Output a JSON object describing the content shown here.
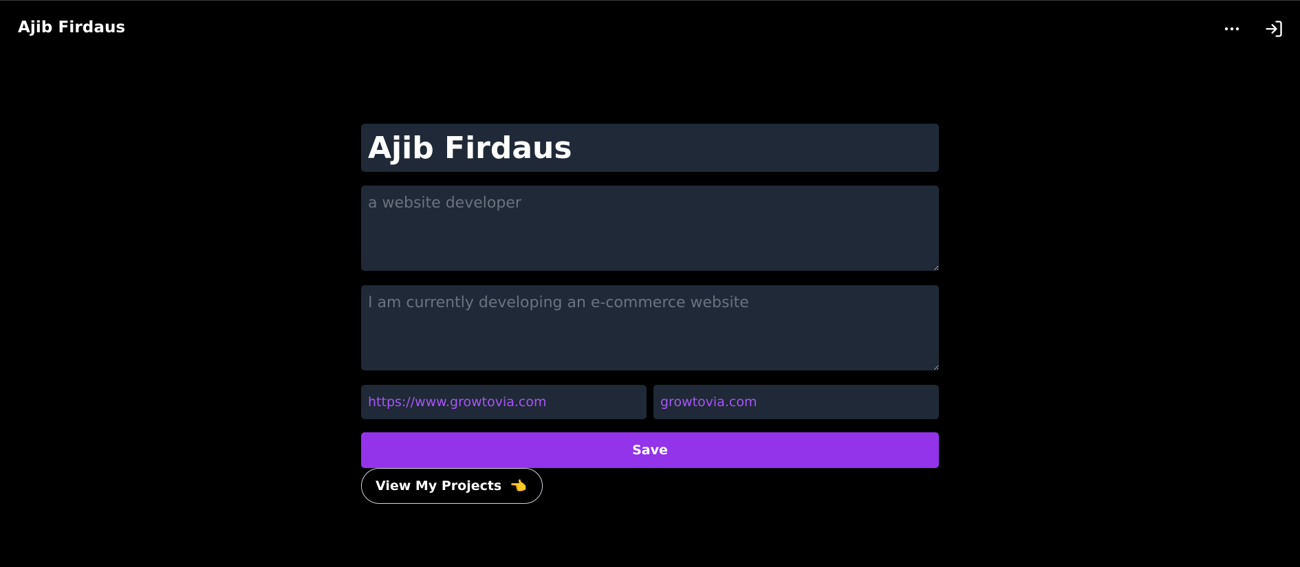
{
  "header": {
    "brand": "Ajib Firdaus",
    "more_icon": "more-horizontal-icon",
    "login_icon": "login-icon"
  },
  "form": {
    "name_value": "Ajib Firdaus",
    "headline_placeholder": "a website developer",
    "headline_value": "",
    "about_placeholder": "I am currently developing an e-commerce website",
    "about_value": "",
    "link_url_placeholder": "https://www.growtovia.com",
    "link_label_placeholder": "growtovia.com",
    "save_label": "Save",
    "projects_label": "View My Projects",
    "projects_emoji": "👈"
  },
  "colors": {
    "background": "#000000",
    "field_bg": "#1f2937",
    "accent": "#9333ea",
    "link_text": "#a855f7",
    "placeholder": "#6b7280"
  }
}
